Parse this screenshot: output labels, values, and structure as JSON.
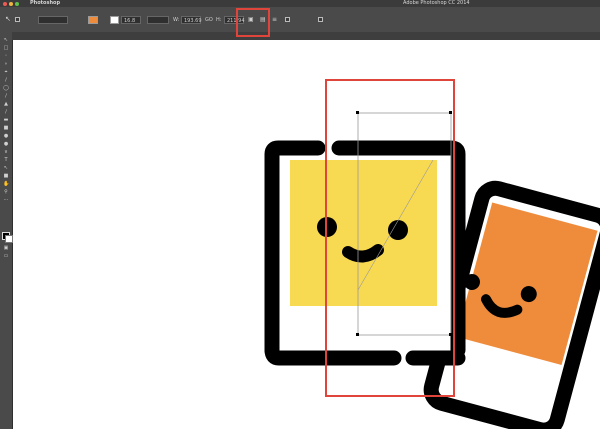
{
  "menubar": {
    "traffic_lights": {
      "close": "#ee5b55",
      "minimize": "#f0b53c",
      "zoom": "#5fc24a"
    },
    "app_name": "Photoshop",
    "menu_items": [
      "",
      "",
      "",
      "",
      "",
      "",
      "",
      "",
      "",
      "",
      ""
    ],
    "window_title": "Adobe Photoshop CC 2014"
  },
  "options_bar": {
    "fill_label": "",
    "fill_color": "#ef8c3c",
    "stroke_label": "",
    "stroke_color": "#ffffff",
    "stroke_width": "16.8",
    "w_label": "W:",
    "w_value": "193.69",
    "go_link": "GO",
    "h_label": "H:",
    "h_value": "211.94",
    "align_edges_label": "",
    "constrain_label": ""
  },
  "document": {
    "tab_title": "",
    "canvas_background": "#ffffff"
  },
  "artwork": {
    "front_fill": "#f8d952",
    "back_fill": "#ef8c3c",
    "ink": "#000000"
  },
  "highlights": {
    "color": "#e0453b"
  }
}
